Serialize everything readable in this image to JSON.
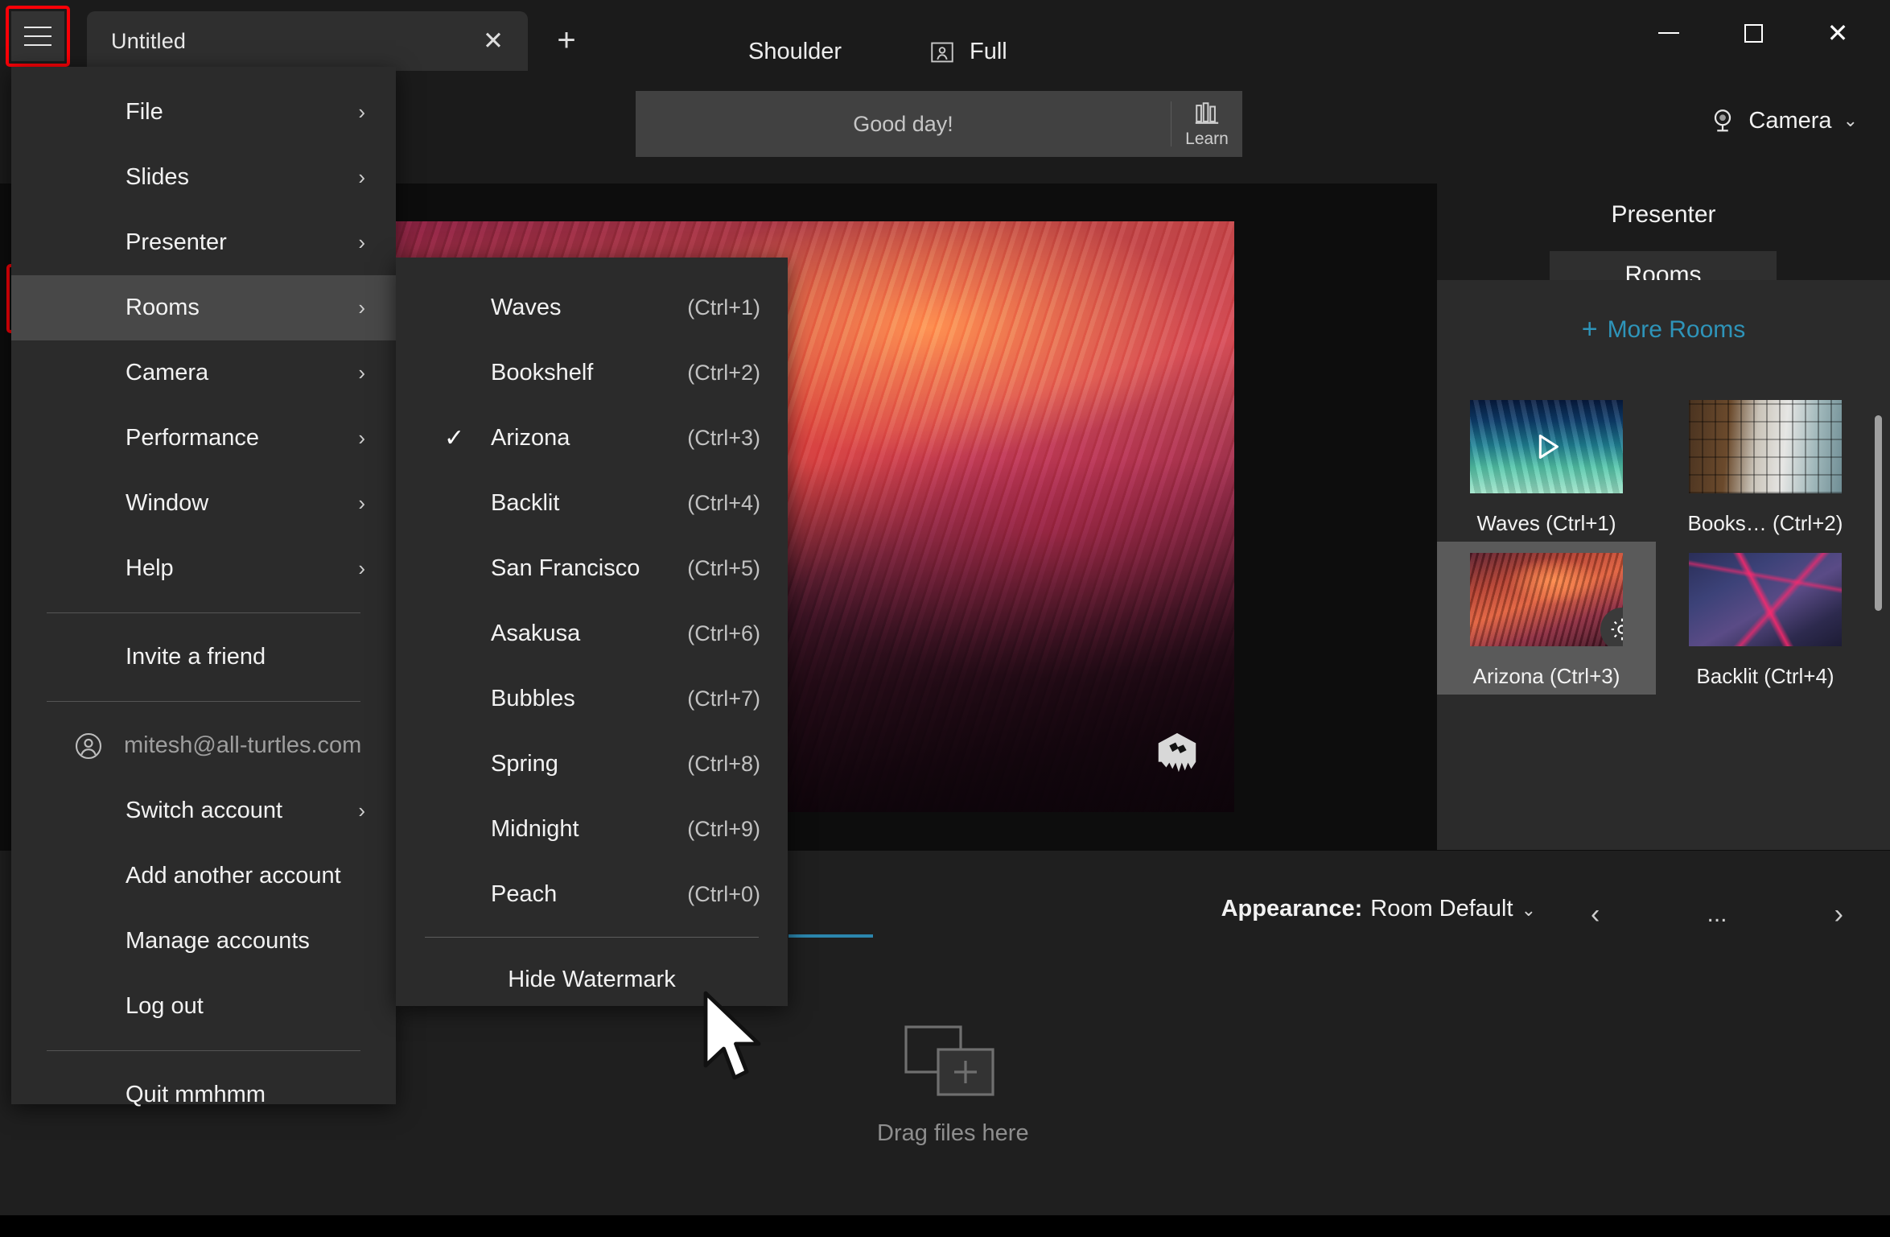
{
  "window": {
    "title": "Untitled",
    "controls": {
      "minimize": "minimize-icon",
      "maximize": "maximize-icon",
      "close": "close-icon"
    },
    "new_tab": "+",
    "tab_close": "✕",
    "hamburger": "hamburger-menu-icon"
  },
  "header": {
    "greeting": "Good day!",
    "learn_label": "Learn",
    "camera_label": "Camera",
    "chevron": "⌄"
  },
  "menu": {
    "items": [
      {
        "label": "File",
        "arrow": "›",
        "has_submenu": true,
        "highlighted": false
      },
      {
        "label": "Slides",
        "arrow": "›",
        "has_submenu": true,
        "highlighted": false
      },
      {
        "label": "Presenter",
        "arrow": "›",
        "has_submenu": true,
        "highlighted": false
      },
      {
        "label": "Rooms",
        "arrow": "›",
        "has_submenu": true,
        "highlighted": true
      },
      {
        "label": "Camera",
        "arrow": "›",
        "has_submenu": true,
        "highlighted": false
      },
      {
        "label": "Performance",
        "arrow": "›",
        "has_submenu": true,
        "highlighted": false
      },
      {
        "label": "Window",
        "arrow": "›",
        "has_submenu": true,
        "highlighted": false
      },
      {
        "label": "Help",
        "arrow": "›",
        "has_submenu": true,
        "highlighted": false
      }
    ],
    "invite_label": "Invite a friend",
    "account_email": "mitesh@all-turtles.com",
    "account_items": [
      {
        "label": "Switch account",
        "arrow": "›",
        "has_submenu": true
      },
      {
        "label": "Add another account",
        "arrow": "",
        "has_submenu": false
      },
      {
        "label": "Manage accounts",
        "arrow": "",
        "has_submenu": false
      },
      {
        "label": "Log out",
        "arrow": "",
        "has_submenu": false
      }
    ],
    "quit_label": "Quit mmhmm"
  },
  "submenu": {
    "rooms": [
      {
        "label": "Waves",
        "accel": "(Ctrl+1)",
        "checked": false
      },
      {
        "label": "Bookshelf",
        "accel": "(Ctrl+2)",
        "checked": false
      },
      {
        "label": "Arizona",
        "accel": "(Ctrl+3)",
        "checked": true
      },
      {
        "label": "Backlit",
        "accel": "(Ctrl+4)",
        "checked": false
      },
      {
        "label": "San Francisco",
        "accel": "(Ctrl+5)",
        "checked": false
      },
      {
        "label": "Asakusa",
        "accel": "(Ctrl+6)",
        "checked": false
      },
      {
        "label": "Bubbles",
        "accel": "(Ctrl+7)",
        "checked": false
      },
      {
        "label": "Spring",
        "accel": "(Ctrl+8)",
        "checked": false
      },
      {
        "label": "Midnight",
        "accel": "(Ctrl+9)",
        "checked": false
      },
      {
        "label": "Peach",
        "accel": "(Ctrl+0)",
        "checked": false
      }
    ],
    "hide_watermark_label": "Hide Watermark",
    "check_glyph": "✓"
  },
  "sidebar": {
    "title": "Presenter",
    "tab_label": "Rooms",
    "more_rooms_label": "More Rooms",
    "more_rooms_plus": "+",
    "rooms": [
      {
        "caption": "Waves (Ctrl+1)",
        "thumb": "thumb-waves",
        "selected": false,
        "has_play": true,
        "has_gear": false
      },
      {
        "caption": "Books… (Ctrl+2)",
        "thumb": "thumb-books",
        "selected": false,
        "has_play": false,
        "has_gear": false
      },
      {
        "caption": "Arizona (Ctrl+3)",
        "thumb": "thumb-arizona",
        "selected": true,
        "has_play": false,
        "has_gear": true
      },
      {
        "caption": "Backlit (Ctrl+4)",
        "thumb": "thumb-backlit",
        "selected": false,
        "has_play": false,
        "has_gear": false
      }
    ]
  },
  "toolbar": {
    "framing_shoulder": "Shoulder",
    "framing_full": "Full",
    "appearance_prefix": "Appearance:",
    "appearance_value": "Room Default",
    "appearance_chevron": "⌄",
    "prev_arrow": "‹",
    "dots": "...",
    "next_arrow": "›",
    "dropzone_label": "Drag files here"
  },
  "colors": {
    "accent_blue": "#2b86ad",
    "link_blue": "#2e94b9",
    "highlight_red": "#fb0007",
    "menu_bg": "#2b2b2b",
    "menu_highlight": "#484848",
    "window_bg": "#1b1b1b",
    "panel_bg": "#2b2b2b"
  }
}
